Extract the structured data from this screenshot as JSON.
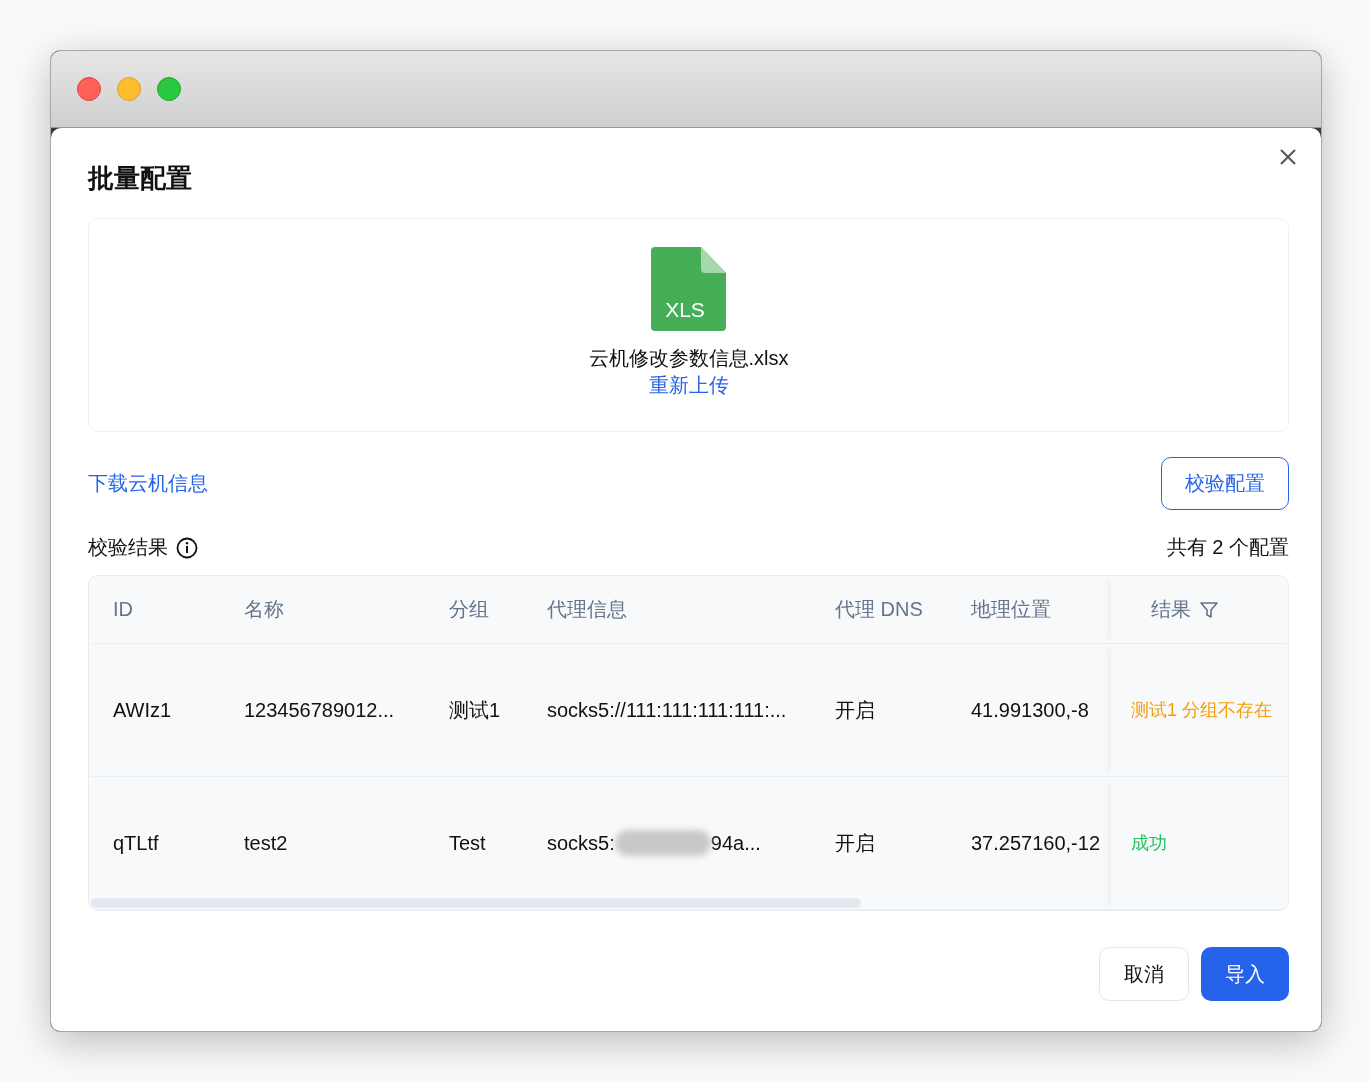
{
  "dialog": {
    "title": "批量配置"
  },
  "upload": {
    "file_badge": "XLS",
    "file_name": "云机修改参数信息.xlsx",
    "reupload_link": "重新上传"
  },
  "download_link": "下载云机信息",
  "validate_button": "校验配置",
  "result_label": "校验结果",
  "total": "共有 2 个配置",
  "table": {
    "columns": [
      "ID",
      "名称",
      "分组",
      "代理信息",
      "代理 DNS",
      "地理位置",
      "结果"
    ],
    "rows": [
      {
        "id": "AWIz1",
        "name": "123456789012...",
        "group": "测试1",
        "proxy_start": "socks5://111:111:111:111:...",
        "proxy_redacted": false,
        "proxy_end": "",
        "dns": "开启",
        "location": "41.991300,-8",
        "result": "测试1 分组不存在",
        "color": "#f59e0b"
      },
      {
        "id": "qTLtf",
        "name": "test2",
        "group": "Test",
        "proxy_start": "socks5:",
        "proxy_redacted": true,
        "proxy_end": "94a...",
        "dns": "开启",
        "location": "37.257160,-12",
        "result": "成功",
        "color": "#22c55e"
      }
    ]
  },
  "buttons": {
    "cancel": "取消",
    "import": "导入"
  }
}
